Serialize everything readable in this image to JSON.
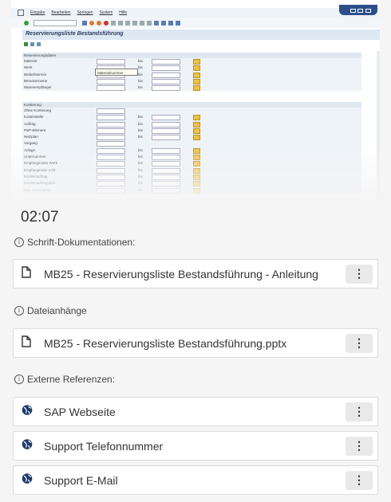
{
  "sap": {
    "menu": [
      "Eingabe",
      "Bearbeiten",
      "Springen",
      "System",
      "Hilfe"
    ],
    "title": "Reservierungsliste Bestandsführung",
    "sections": [
      {
        "head": "Reservierungsdaten",
        "rows": [
          {
            "label": "Material",
            "bis": "bis"
          },
          {
            "label": "Werk",
            "bis": "bis"
          },
          {
            "label": "Bedarfstermin",
            "bis": "bis"
          },
          {
            "label": "Benutzername",
            "bis": "bis"
          },
          {
            "label": "Warenempfänger",
            "bis": "bis"
          }
        ]
      },
      {
        "head": "Kontierung",
        "rows": [
          {
            "label": "Ohne Kontierung",
            "bis": ""
          },
          {
            "label": "Kostenstelle",
            "bis": "bis"
          },
          {
            "label": "Auftrag",
            "bis": "bis"
          },
          {
            "label": "PSP-Element",
            "bis": "bis"
          },
          {
            "label": "Netzplan",
            "bis": "bis"
          },
          {
            "label": "Vorgang",
            "bis": ""
          },
          {
            "label": "Anlage",
            "bis": "bis"
          },
          {
            "label": "Unternummer",
            "bis": "bis"
          },
          {
            "label": "Empfangendes Werk",
            "bis": "bis"
          },
          {
            "label": "Empfangender LOrt",
            "bis": "bis"
          },
          {
            "label": "Kundenauftrag",
            "bis": "bis"
          },
          {
            "label": "Kundenauftragspos.",
            "bis": "bis"
          },
          {
            "label": "Ges. Geschäftsp.",
            "bis": "bis"
          }
        ]
      }
    ],
    "tooltip": "Materialnummer"
  },
  "timer": "02:07",
  "docs_label": "Schrift-Dokumentationen:",
  "attach_label": "Dateianhänge",
  "refs_label": "Externe Referenzen:",
  "cards": {
    "doc1": "MB25 - Reservierungsliste Bestandsführung - Anleitung",
    "att1": "MB25 - Reservierungsliste Bestandsführung.pptx",
    "ref1": "SAP Webseite",
    "ref2": "Support Telefonnummer",
    "ref3": "Support E-Mail"
  },
  "icons": {
    "doc": "file-icon",
    "web": "globe-icon",
    "menu": "kebab-menu-icon",
    "info": "info-icon"
  },
  "colors": {
    "accent": "#2c4f8a",
    "card_bg": "#ffffff",
    "menu_btn": "#e9e9e9"
  }
}
